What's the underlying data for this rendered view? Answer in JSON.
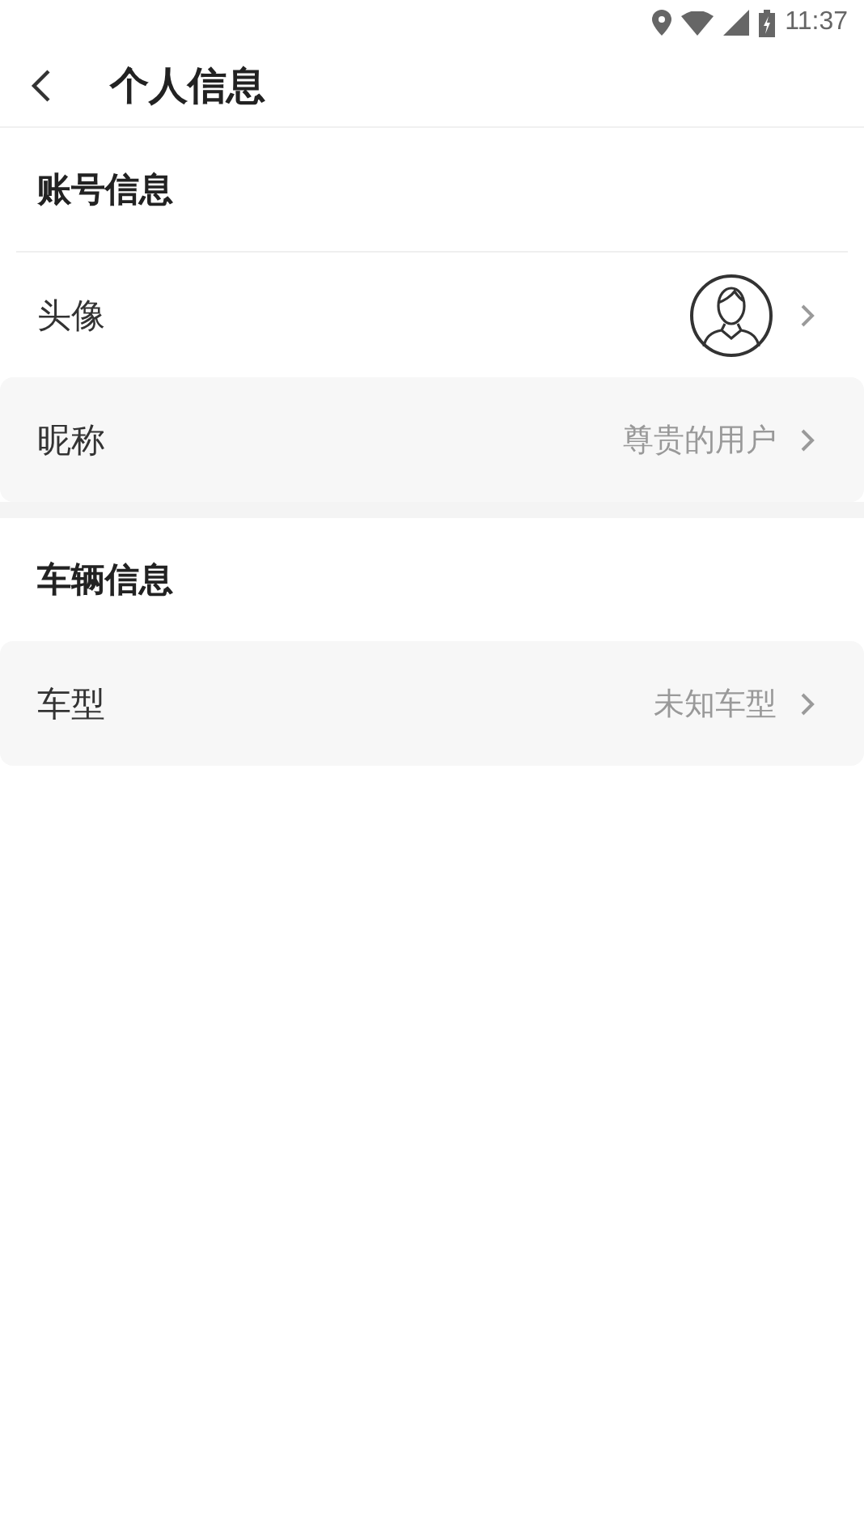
{
  "status_bar": {
    "time": "11:37"
  },
  "header": {
    "title": "个人信息"
  },
  "sections": [
    {
      "title": "账号信息",
      "rows": [
        {
          "kind": "avatar",
          "label": "头像"
        },
        {
          "kind": "text",
          "label": "昵称",
          "value": "尊贵的用户"
        }
      ]
    },
    {
      "title": "车辆信息",
      "rows": [
        {
          "kind": "text",
          "label": "车型",
          "value": "未知车型"
        }
      ]
    }
  ]
}
